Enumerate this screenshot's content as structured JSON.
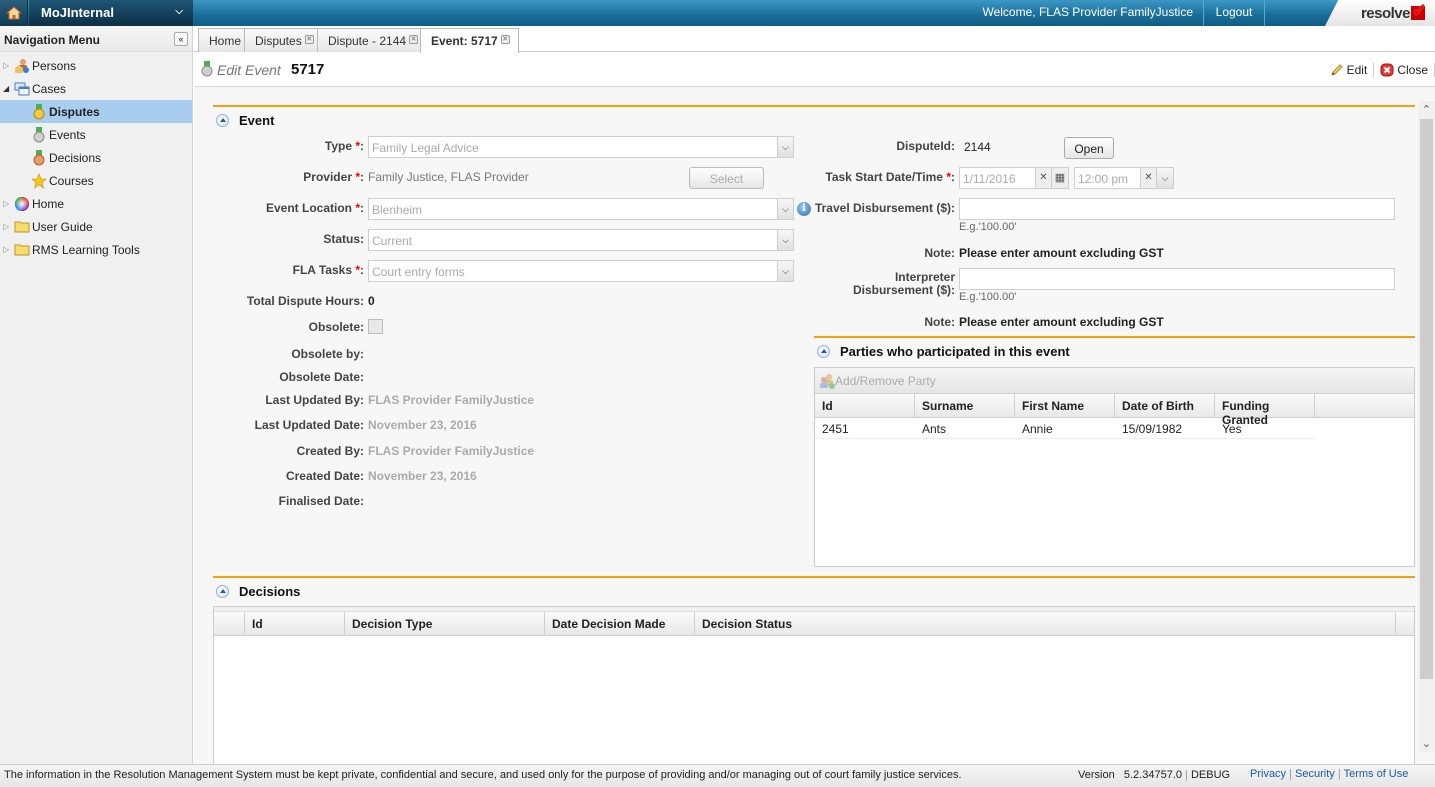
{
  "topbar": {
    "app_name": "MoJInternal",
    "welcome": "Welcome, FLAS Provider FamilyJustice",
    "logout": "Logout",
    "brand": "resolve"
  },
  "sidebar": {
    "title": "Navigation Menu",
    "items": [
      {
        "label": "Persons",
        "icon": "persons-icon",
        "expander": "collapsed"
      },
      {
        "label": "Cases",
        "icon": "cases-icon",
        "expander": "expanded"
      },
      {
        "label": "Disputes",
        "icon": "gold-medal-icon",
        "child": true,
        "active": true
      },
      {
        "label": "Events",
        "icon": "silver-medal-icon",
        "child": true
      },
      {
        "label": "Decisions",
        "icon": "bronze-medal-icon",
        "child": true
      },
      {
        "label": "Courses",
        "icon": "star-icon",
        "child": true
      },
      {
        "label": "Home",
        "icon": "color-wheel-icon",
        "expander": "collapsed"
      },
      {
        "label": "User Guide",
        "icon": "folder-icon",
        "expander": "collapsed"
      },
      {
        "label": "RMS Learning Tools",
        "icon": "folder-icon",
        "expander": "collapsed"
      }
    ]
  },
  "tabs": [
    {
      "label": "Home",
      "closable": false
    },
    {
      "label": "Disputes",
      "closable": true
    },
    {
      "label": "Dispute - 2144",
      "closable": true
    },
    {
      "label": "Event: 5717",
      "closable": true,
      "active": true
    }
  ],
  "page": {
    "mode_label": "Edit Event",
    "record_id": "5717",
    "actions": {
      "edit": "Edit",
      "close": "Close"
    }
  },
  "event_section": {
    "title": "Event",
    "left": {
      "type": {
        "label": "Type",
        "value": "Family Legal Advice",
        "required": true
      },
      "provider": {
        "label": "Provider",
        "value": "Family Justice, FLAS Provider",
        "required": true,
        "button": "Select"
      },
      "event_location": {
        "label": "Event Location",
        "value": "Blenheim",
        "required": true
      },
      "status": {
        "label": "Status:",
        "value": "Current"
      },
      "fla_tasks": {
        "label": "FLA Tasks",
        "value": "Court entry forms",
        "required": true
      },
      "total_dispute_hours": {
        "label": "Total Dispute Hours:",
        "value": "0"
      },
      "obsolete": {
        "label": "Obsolete:",
        "checked": false
      },
      "obsolete_by": {
        "label": "Obsolete by:",
        "value": ""
      },
      "obsolete_date": {
        "label": "Obsolete Date:",
        "value": ""
      },
      "last_updated_by": {
        "label": "Last Updated By:",
        "value": "FLAS Provider FamilyJustice"
      },
      "last_updated_date": {
        "label": "Last Updated Date:",
        "value": "November 23, 2016"
      },
      "created_by": {
        "label": "Created By:",
        "value": "FLAS Provider FamilyJustice"
      },
      "created_date": {
        "label": "Created Date:",
        "value": "November 23, 2016"
      },
      "finalised_date": {
        "label": "Finalised Date:",
        "value": ""
      }
    },
    "right": {
      "dispute_id": {
        "label": "DisputeId:",
        "value": "2144",
        "button": "Open"
      },
      "task_start": {
        "label": "Task Start Date/Time",
        "required": true,
        "date": "1/11/2016",
        "time": "12:00 pm"
      },
      "travel": {
        "label": "Travel Disbursement ($):",
        "value": "",
        "hint": "E.g.'100.00'"
      },
      "travel_note": {
        "label": "Note:",
        "value": "Please enter amount excluding GST"
      },
      "interpreter": {
        "label_line1": "Interpreter",
        "label_line2": "Disbursement ($):",
        "value": "",
        "hint": "E.g.'100.00'"
      },
      "interpreter_note": {
        "label": "Note:",
        "value": "Please enter amount excluding GST"
      }
    }
  },
  "parties_section": {
    "title": "Parties who participated in this event",
    "toolbar_button": "Add/Remove Party",
    "columns": [
      "Id",
      "Surname",
      "First Name",
      "Date of Birth",
      "Funding Granted"
    ],
    "rows": [
      {
        "id": "2451",
        "surname": "Ants",
        "first_name": "Annie",
        "dob": "15/09/1982",
        "funding": "Yes"
      }
    ]
  },
  "decisions_section": {
    "title": "Decisions",
    "columns": [
      "Id",
      "Decision Type",
      "Date Decision Made",
      "Decision Status"
    ],
    "rows": []
  },
  "footer": {
    "message": "The information in the Resolution Management System must be kept private, confidential and secure, and used only for the purpose of providing and/or managing out of court family justice services.",
    "version_label": "Version",
    "version": "5.2.34757.0",
    "build": "DEBUG",
    "links": [
      "Privacy",
      "Security",
      "Terms of Use"
    ]
  }
}
